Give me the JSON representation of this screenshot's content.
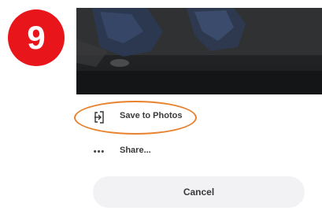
{
  "step_badge": {
    "number": "9",
    "color": "#e8151b"
  },
  "actions": [
    {
      "icon": "save-to-device-icon",
      "label": "Save to Photos"
    },
    {
      "icon": "more-dots-icon",
      "label": "Share..."
    }
  ],
  "cancel_label": "Cancel",
  "highlight_color": "#e8822e"
}
